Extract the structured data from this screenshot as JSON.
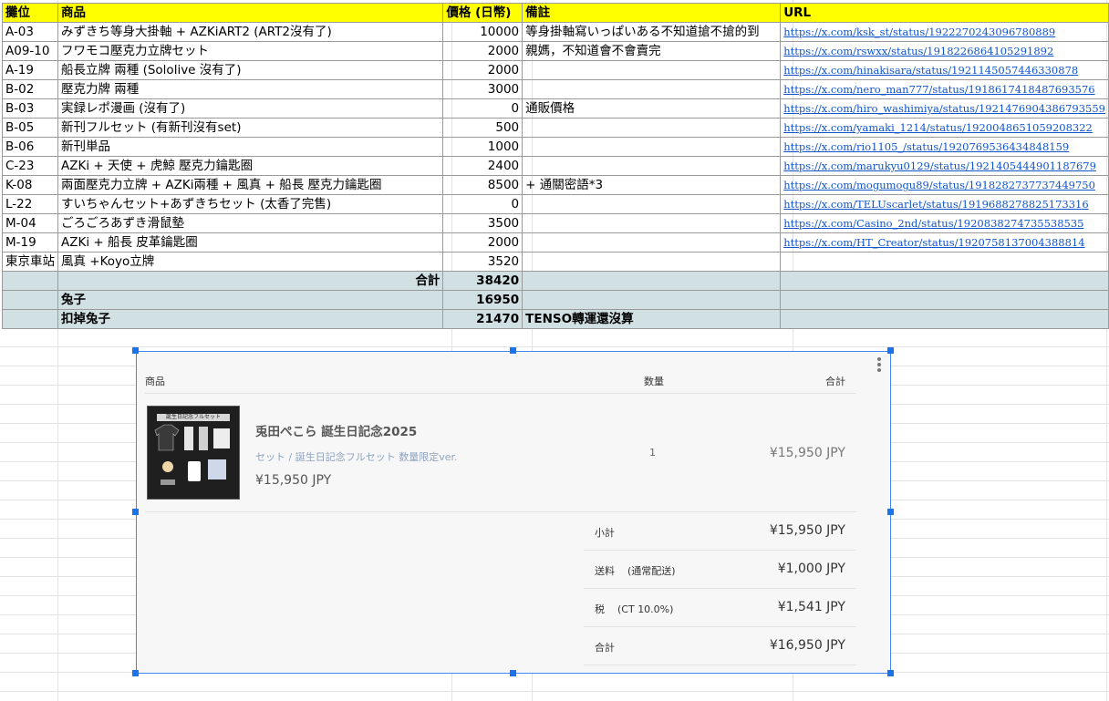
{
  "table": {
    "headers": [
      "攤位",
      "商品",
      "價格 (日幣)",
      "備註",
      "URL"
    ],
    "rows": [
      {
        "booth": "A-03",
        "item": "みずきち等身大掛軸 + AZKiART2 (ART2沒有了)",
        "price": "10000",
        "note": "等身掛軸寫いっぱいある不知道搶不搶的到",
        "url": "https://x.com/ksk_st/status/1922270243096780889"
      },
      {
        "booth": "A09-10",
        "item": "フワモコ壓克力立牌セット",
        "price": "2000",
        "note": "親媽，不知道會不會賣完",
        "url": "https://x.com/rswxx/status/1918226864105291892"
      },
      {
        "booth": "A-19",
        "item": "船長立牌 兩種 (Sololive 沒有了)",
        "price": "2000",
        "note": "",
        "url": "https://x.com/hinakisara/status/1921145057446330878"
      },
      {
        "booth": "B-02",
        "item": "壓克力牌 兩種",
        "price": "3000",
        "note": "",
        "url": "https://x.com/nero_man777/status/1918617418487693576"
      },
      {
        "booth": "B-03",
        "item": "実録レポ漫画 (沒有了)",
        "price": "0",
        "note": "通販價格",
        "url": "https://x.com/hiro_washimiya/status/1921476904386793559"
      },
      {
        "booth": "B-05",
        "item": "新刊フルセット (有新刊沒有set)",
        "price": "500",
        "note": "",
        "url": "https://x.com/yamaki_1214/status/1920048651059208322"
      },
      {
        "booth": "B-06",
        "item": "新刊単品",
        "price": "1000",
        "note": "",
        "url": "https://x.com/rio1105_/status/1920769536434848159"
      },
      {
        "booth": "C-23",
        "item": "AZKi + 天使 + 虎鯨  壓克力鑰匙圈",
        "price": "2400",
        "note": "",
        "url": "https://x.com/marukyu0129/status/1921405444901187679"
      },
      {
        "booth": "K-08",
        "item": "兩面壓克力立牌 + AZKi兩種 + 風真 + 船長 壓克力鑰匙圈",
        "price": "8500",
        "note": "+ 通關密語*3",
        "url": "https://x.com/mogumogu89/status/1918282737737449750"
      },
      {
        "booth": "L-22",
        "item": "すいちゃんセット+あずきちセット (太香了完售)",
        "price": "0",
        "note": "",
        "url": "https://x.com/TELUscarlet/status/1919688278825173316"
      },
      {
        "booth": "M-04",
        "item": "ごろごろあずき滑鼠墊",
        "price": "3500",
        "note": "",
        "url": "https://x.com/Casino_2nd/status/1920838274735538535"
      },
      {
        "booth": "M-19",
        "item": "AZKi + 船長  皮革鑰匙圈",
        "price": "2000",
        "note": "",
        "url": "https://x.com/HT_Creator/status/1920758137004388814"
      },
      {
        "booth": "東京車站",
        "item": "風真 +Koyo立牌",
        "price": "3520",
        "note": "",
        "url": ""
      }
    ],
    "total_label": "合計",
    "total_value": "38420",
    "rabbit_label": "兔子",
    "rabbit_value": "16950",
    "net_label": "扣掉兔子",
    "net_value": "21470",
    "net_note": "TENSO轉運還沒算"
  },
  "embed": {
    "col_item": "商品",
    "col_qty": "数量",
    "col_total": "合計",
    "thumb_caption": "誕生日記念フルセット",
    "product_title": "兎田ぺこら 誕生日記念2025",
    "product_variant": "セット / 誕生日記念フルセット 数量限定ver.",
    "product_price": "¥15,950 JPY",
    "quantity": "1",
    "line_total": "¥15,950 JPY",
    "subtotal_label": "小計",
    "subtotal_value": "¥15,950 JPY",
    "shipping_label": "送料",
    "shipping_method": "(通常配送)",
    "shipping_value": "¥1,000 JPY",
    "tax_label": "税",
    "tax_rate": "(CT 10.0%)",
    "tax_value": "¥1,541 JPY",
    "grand_label": "合計",
    "grand_value": "¥16,950 JPY"
  }
}
